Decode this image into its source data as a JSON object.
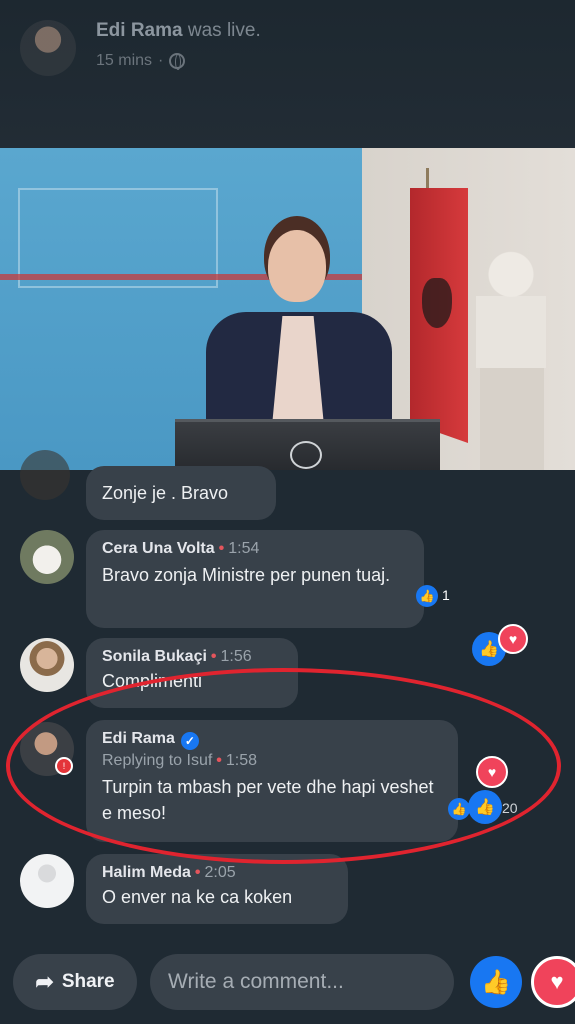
{
  "post": {
    "author": "Edi Rama",
    "status": "was live.",
    "time": "15 mins",
    "privacy_icon": "globe-icon"
  },
  "comments": [
    {
      "name": "",
      "time": "",
      "text": "Zonje je  . Bravo",
      "partial": true
    },
    {
      "name": "Cera Una Volta",
      "time": "1:54",
      "text": "Bravo zonja Ministre per punen tuaj.",
      "reactions": "1"
    },
    {
      "name": "Sonila Bukaçi",
      "time": "1:56",
      "text": "Complimenti"
    },
    {
      "name": "Edi Rama",
      "verified": true,
      "reply_to": "Replying to Isuf",
      "time": "1:58",
      "text": "Turpin ta mbash per vete dhe hapi veshet e meso!",
      "reactions": "20"
    },
    {
      "name": "Halim Meda",
      "time": "2:05",
      "text": "O enver na ke ca koken"
    }
  ],
  "bottom_bar": {
    "share_label": "Share",
    "comment_placeholder": "Write a comment...",
    "like_icon": "thumbs-up-icon",
    "love_icon": "heart-icon"
  },
  "colors": {
    "background": "#1f2a33",
    "bubble": "#38414a",
    "like_blue": "#1877f2",
    "love_red": "#f0435b",
    "highlight_ellipse": "#e0242f"
  }
}
